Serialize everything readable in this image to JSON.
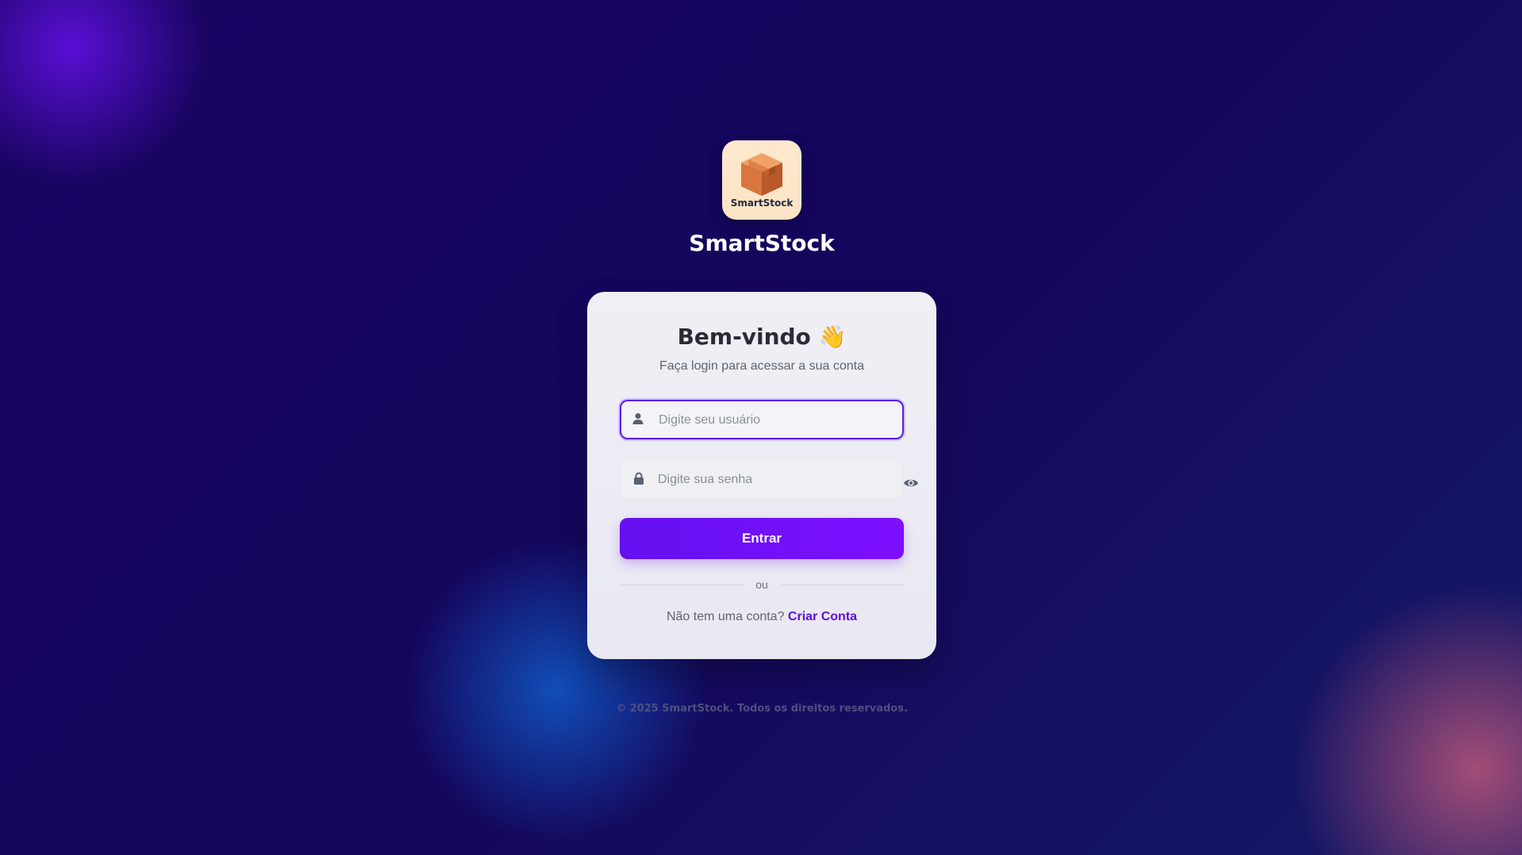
{
  "brand": {
    "name": "SmartStock",
    "logo_text": "SmartStock",
    "logo_icon": "package-box-icon"
  },
  "card": {
    "heading": "Bem-vindo 👋",
    "subtitle": "Faça login para acessar a sua conta"
  },
  "form": {
    "username_placeholder": "Digite seu usuário",
    "password_placeholder": "Digite sua senha",
    "submit_label": "Entrar"
  },
  "divider_text": "ou",
  "signup": {
    "prompt": "Não tem uma conta?",
    "link_label": "Criar Conta"
  },
  "footer": "© 2025 SmartStock. Todos os direitos reservados.",
  "colors": {
    "accent": "#6410f0",
    "background": "#170660",
    "card": "#f0eff5"
  }
}
